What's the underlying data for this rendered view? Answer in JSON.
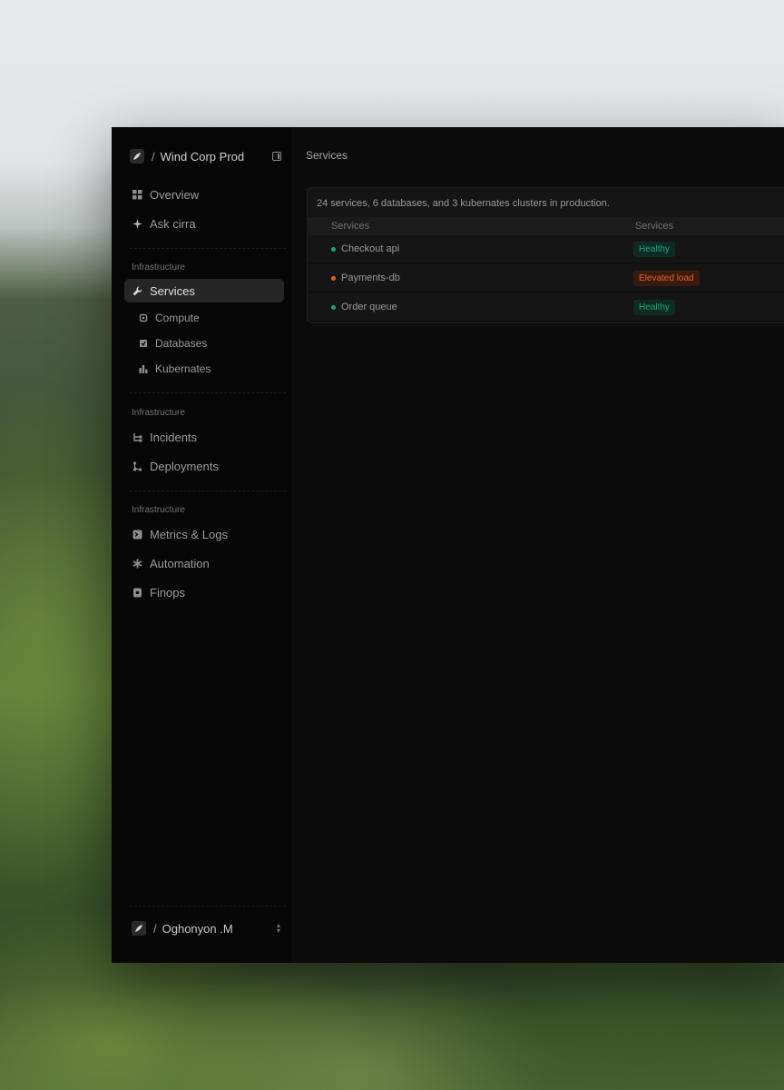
{
  "workspace": {
    "name": "Wind Corp Prod",
    "separator": "/",
    "logo_icon": "leaf-icon"
  },
  "sidebar": {
    "top_items": [
      {
        "label": "Overview",
        "icon": "grid-icon"
      },
      {
        "label": "Ask cirra",
        "icon": "sparkle-icon"
      }
    ],
    "sections": [
      {
        "label": "Infrastructure",
        "items": [
          {
            "label": "Services",
            "icon": "wrench-icon",
            "active": true
          }
        ],
        "sub_items": [
          {
            "label": "Compute",
            "icon": "chip-icon"
          },
          {
            "label": "Databases",
            "icon": "database-icon"
          },
          {
            "label": "Kubernates",
            "icon": "bar-chart-icon"
          }
        ]
      },
      {
        "label": "Infrastructure",
        "items": [
          {
            "label": "Incidents",
            "icon": "tree-icon"
          },
          {
            "label": "Deployments",
            "icon": "branch-icon"
          }
        ]
      },
      {
        "label": "Infrastructure",
        "items": [
          {
            "label": "Metrics & Logs",
            "icon": "terminal-icon"
          },
          {
            "label": "Automation",
            "icon": "asterisk-icon"
          },
          {
            "label": "Finops",
            "icon": "receipt-icon"
          }
        ]
      }
    ]
  },
  "user": {
    "name": "Oghonyon .M",
    "separator": "/"
  },
  "main": {
    "title": "Services",
    "summary": "24 services, 6 databases, and 3 kubernates clusters in production.",
    "table": {
      "columns": [
        "Services",
        "Services"
      ],
      "rows": [
        {
          "name": "Checkout api",
          "status": "Healthy",
          "status_color": "#1fa37a"
        },
        {
          "name": "Payments-db",
          "status": "Elevated load",
          "status_color": "#e0622b"
        },
        {
          "name": "Order queue",
          "status": "Healthy",
          "status_color": "#1fa37a"
        }
      ]
    }
  },
  "colors": {
    "healthy": "#1fa37a",
    "healthy_bg": "#0f2a22",
    "elevated": "#e0622b",
    "elevated_bg": "#3a1a0e"
  }
}
